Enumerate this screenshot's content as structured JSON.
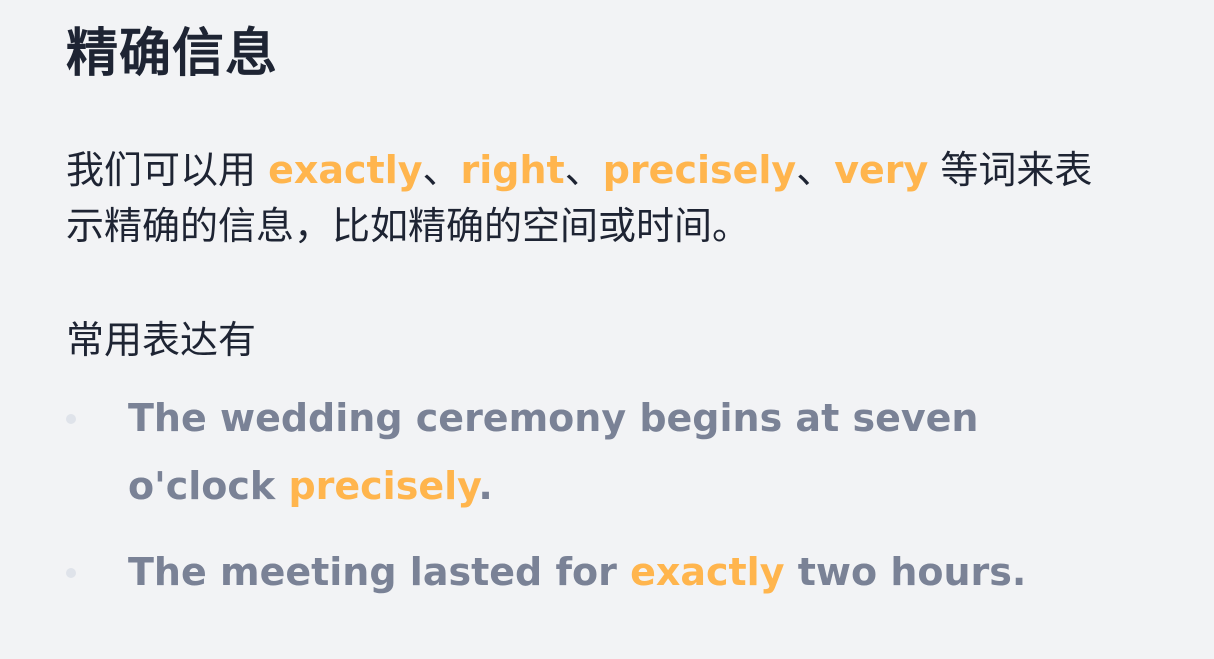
{
  "title": "精确信息",
  "intro": {
    "before": "我们可以用 ",
    "word1": "exactly",
    "sep1": "、",
    "word2": "right",
    "sep2": "、",
    "word3": "precisely",
    "sep3": "、",
    "word4": "very",
    "after": " 等词来表示精确的信息，比如精确的空间或时间。"
  },
  "subheading": "常用表达有",
  "examples": [
    {
      "before": "The wedding ceremony begins at seven o'clock ",
      "highlight": "precisely",
      "after": "."
    },
    {
      "before": "The meeting lasted for ",
      "highlight": "exactly",
      "after": " two hours."
    }
  ],
  "colors": {
    "highlight": "#ffb54d",
    "text": "#1e2433",
    "example_text": "#7a8296",
    "background": "#f2f3f5"
  }
}
